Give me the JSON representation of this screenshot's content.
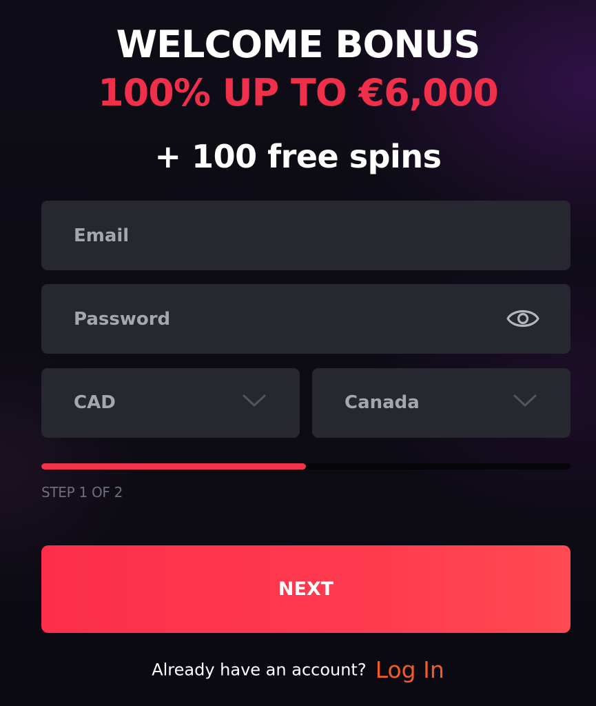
{
  "header": {
    "title": "WELCOME BONUS",
    "offer": "100% UP TO €6,000",
    "spins": "+ 100 free spins"
  },
  "form": {
    "email_placeholder": "Email",
    "password_placeholder": "Password",
    "currency": "CAD",
    "country": "Canada",
    "step_label": "STEP 1 OF 2",
    "progress_percent": 50,
    "next_label": "NEXT"
  },
  "footer": {
    "prompt": "Already have an account?",
    "login_label": "Log In"
  },
  "icons": {
    "password_toggle": "eye-icon",
    "dropdown": "chevron-down-icon"
  },
  "colors": {
    "accent": "#f0304a",
    "link": "#f25d22",
    "field_bg": "#272730",
    "button": "#fd2e4b"
  }
}
